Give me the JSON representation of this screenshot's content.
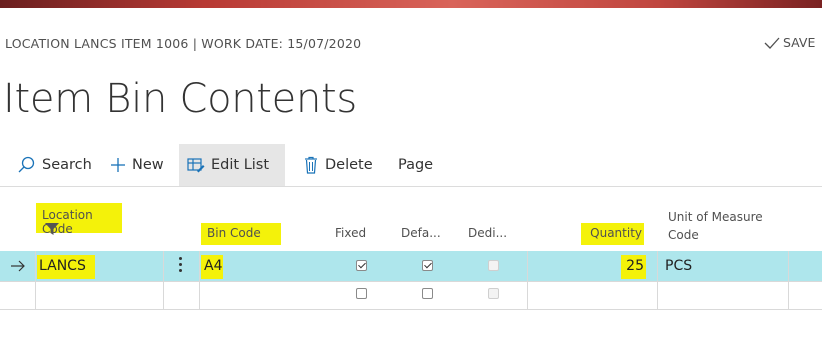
{
  "header": {
    "breadcrumb": "LOCATION LANCS ITEM 1006 | WORK DATE: 15/07/2020",
    "save_label": "SAVE",
    "title": "Item Bin Contents"
  },
  "toolbar": {
    "search": "Search",
    "new": "New",
    "edit_list": "Edit List",
    "delete": "Delete",
    "page": "Page"
  },
  "columns": {
    "location_code": "Location Code",
    "bin_code": "Bin Code",
    "fixed": "Fixed",
    "default": "Defa...",
    "dedicated": "Dedi...",
    "quantity": "Quantity",
    "uom_line1": "Unit of Measure",
    "uom_line2": "Code"
  },
  "rows": [
    {
      "location_code": "LANCS",
      "bin_code": "A4",
      "fixed": true,
      "default": true,
      "dedicated": false,
      "quantity": "25",
      "uom": "PCS"
    },
    {
      "location_code": "",
      "bin_code": "",
      "fixed": false,
      "default": false,
      "dedicated": false,
      "quantity": "",
      "uom": ""
    }
  ],
  "colors": {
    "highlight": "#f4f20a",
    "selected_row": "#aee6ec",
    "active_button": "#e6e6e6"
  }
}
